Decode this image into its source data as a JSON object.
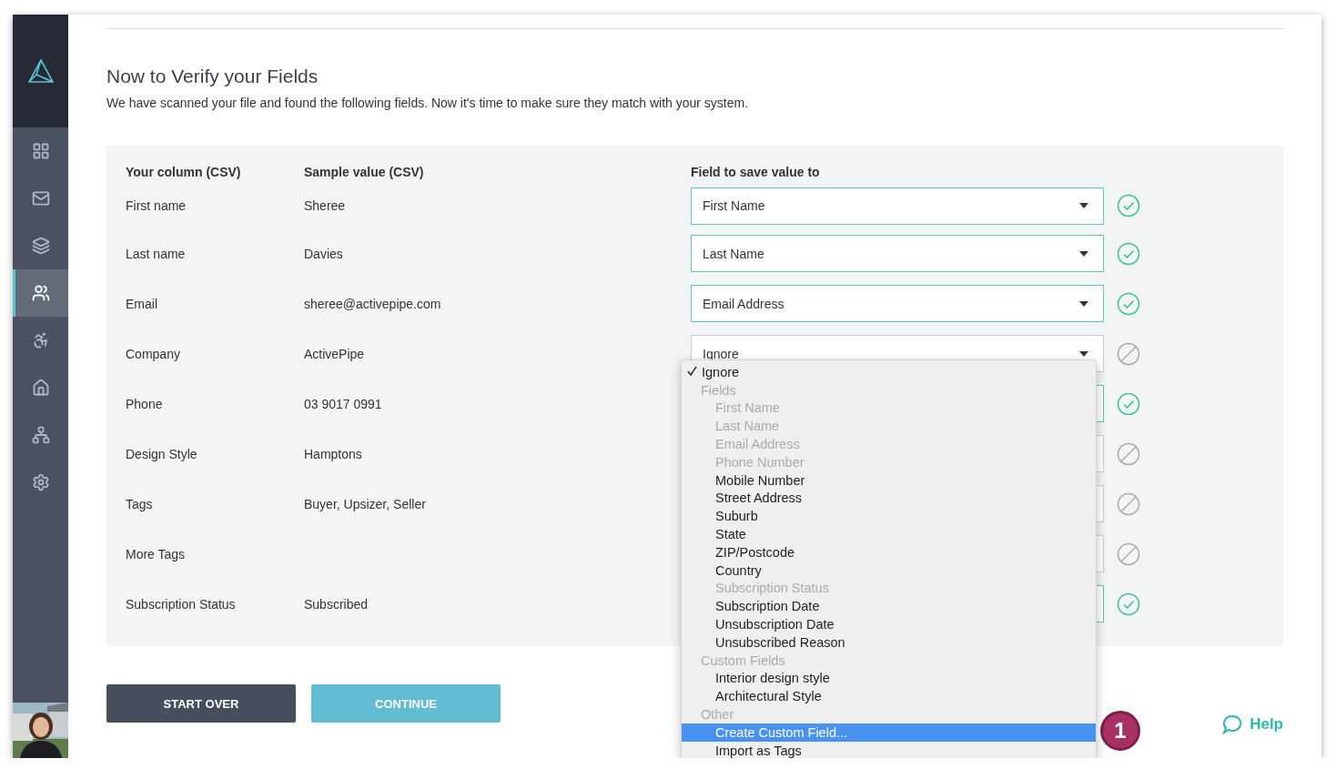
{
  "sidebar": {
    "items": [
      {
        "selected": false
      },
      {
        "selected": false
      },
      {
        "selected": false
      },
      {
        "selected": true
      },
      {
        "selected": false
      },
      {
        "selected": false
      },
      {
        "selected": false
      },
      {
        "selected": false
      }
    ]
  },
  "heading": {
    "title": "Now to Verify your Fields",
    "subtitle": "We have scanned your file and found the following fields. Now it's time to make sure they match with your system."
  },
  "table": {
    "columns": [
      "Your column (CSV)",
      "Sample value (CSV)",
      "Field to save value to"
    ],
    "rows": [
      {
        "column": "First name",
        "sample": "Sheree",
        "field": "First Name",
        "matched": true
      },
      {
        "column": "Last name",
        "sample": "Davies",
        "field": "Last Name",
        "matched": true
      },
      {
        "column": "Email",
        "sample": "sheree@activepipe.com",
        "field": "Email Address",
        "matched": true
      },
      {
        "column": "Company",
        "sample": "ActivePipe",
        "field": "Ignore",
        "matched": false
      },
      {
        "column": "Phone",
        "sample": "03 9017 0991",
        "matched": true
      },
      {
        "column": "Design Style",
        "sample": "Hamptons",
        "matched": false
      },
      {
        "column": "Tags",
        "sample": "Buyer, Upsizer, Seller",
        "matched": false
      },
      {
        "column": "More Tags",
        "matched": false
      },
      {
        "column": "Subscription Status",
        "sample": "Subscribed",
        "matched": true
      }
    ]
  },
  "dropdown": {
    "options": [
      {
        "label": "Ignore",
        "selected": true,
        "disabled": false,
        "highlighted": false
      }
    ],
    "groups": [
      {
        "label": "Fields",
        "options": [
          {
            "label": "First Name",
            "selected": false,
            "disabled": true,
            "highlighted": false
          },
          {
            "label": "Last Name",
            "selected": false,
            "disabled": true,
            "highlighted": false
          },
          {
            "label": "Email Address",
            "selected": false,
            "disabled": true,
            "highlighted": false
          },
          {
            "label": "Phone Number",
            "selected": false,
            "disabled": true,
            "highlighted": false
          },
          {
            "label": "Mobile Number",
            "selected": false,
            "disabled": false,
            "highlighted": false
          },
          {
            "label": "Street Address",
            "selected": false,
            "disabled": false,
            "highlighted": false
          },
          {
            "label": "Suburb",
            "selected": false,
            "disabled": false,
            "highlighted": false
          },
          {
            "label": "State",
            "selected": false,
            "disabled": false,
            "highlighted": false
          },
          {
            "label": "ZIP/Postcode",
            "selected": false,
            "disabled": false,
            "highlighted": false
          },
          {
            "label": "Country",
            "selected": false,
            "disabled": false,
            "highlighted": false
          },
          {
            "label": "Subscription Status",
            "selected": false,
            "disabled": true,
            "highlighted": false
          },
          {
            "label": "Subscription Date",
            "selected": false,
            "disabled": false,
            "highlighted": false
          },
          {
            "label": "Unsubscription Date",
            "selected": false,
            "disabled": false,
            "highlighted": false
          },
          {
            "label": "Unsubscribed Reason",
            "selected": false,
            "disabled": false,
            "highlighted": false
          }
        ]
      },
      {
        "label": "Custom Fields",
        "options": [
          {
            "label": "Interior design style",
            "selected": false,
            "disabled": false,
            "highlighted": false
          },
          {
            "label": "Architectural Style",
            "selected": false,
            "disabled": false,
            "highlighted": false
          }
        ]
      },
      {
        "label": "Other",
        "options": [
          {
            "label": "Create Custom Field...",
            "selected": false,
            "disabled": false,
            "highlighted": true
          },
          {
            "label": "Import as Tags",
            "selected": false,
            "disabled": false,
            "highlighted": false
          }
        ]
      }
    ]
  },
  "buttons": {
    "start_over": "START OVER",
    "continue": "CONTINUE"
  },
  "step_badge": "1",
  "help": "Help"
}
